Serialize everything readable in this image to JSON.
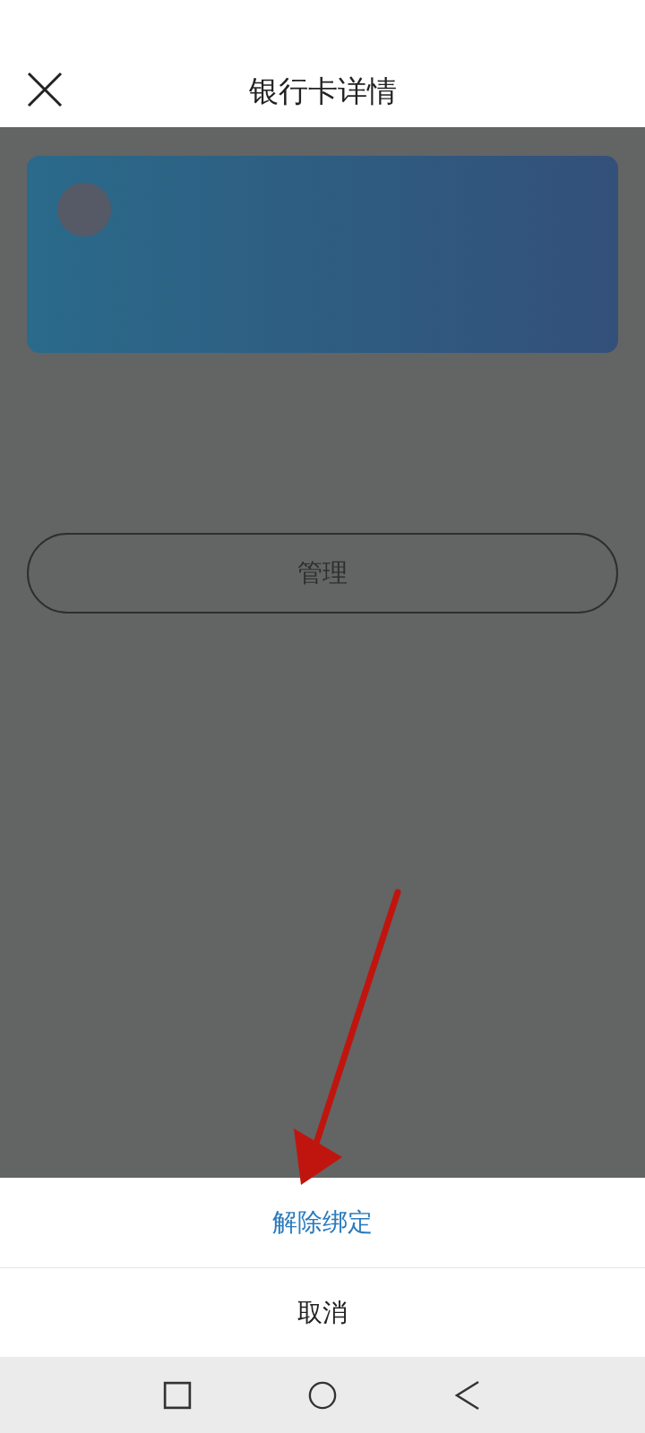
{
  "header": {
    "title": "银行卡详情"
  },
  "manage_button": {
    "label": "管理"
  },
  "action_sheet": {
    "items": [
      {
        "label": "解除绑定",
        "kind": "action"
      },
      {
        "label": "取消",
        "kind": "cancel"
      }
    ]
  }
}
